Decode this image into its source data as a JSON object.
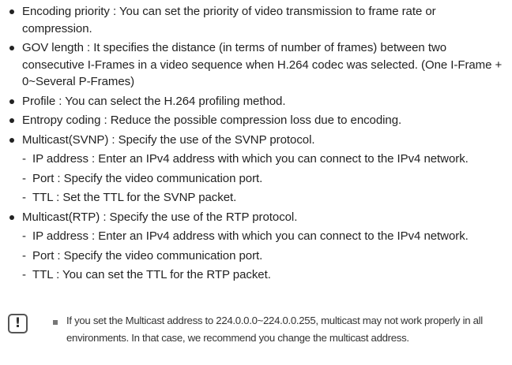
{
  "items": [
    {
      "type": "bullet",
      "text": "Encoding priority : You can set the priority of video transmission to frame rate or compression."
    },
    {
      "type": "bullet",
      "text": "GOV length : It specifies the distance (in terms of number of frames) between two consecutive I-Frames in a video sequence when H.264 codec was selected. (One I-Frame + 0~Several P-Frames)"
    },
    {
      "type": "bullet",
      "text": "Profile : You can select the H.264 profiling method."
    },
    {
      "type": "bullet",
      "text": "Entropy coding : Reduce the possible compression loss due to encoding."
    },
    {
      "type": "bullet",
      "text": "Multicast(SVNP) : Specify the use of the SVNP protocol."
    },
    {
      "type": "sub",
      "text": "IP address : Enter an IPv4 address with which you can connect to the IPv4 network."
    },
    {
      "type": "sub",
      "text": "Port : Specify the video communication port."
    },
    {
      "type": "sub",
      "text": "TTL : Set the TTL for the SVNP packet."
    },
    {
      "type": "bullet",
      "text": "Multicast(RTP) : Specify the use of the RTP protocol."
    },
    {
      "type": "sub",
      "text": "IP address : Enter an IPv4 address with which you can connect to the IPv4 network."
    },
    {
      "type": "sub",
      "text": "Port : Specify the video communication port."
    },
    {
      "type": "sub",
      "text": "TTL : You can set the TTL for the RTP packet."
    }
  ],
  "note": {
    "icon": "exclamation-icon",
    "text": "If you set the Multicast address to 224.0.0.0~224.0.0.255, multicast may not work properly in all environments. In that case, we recommend you change the multicast address."
  }
}
